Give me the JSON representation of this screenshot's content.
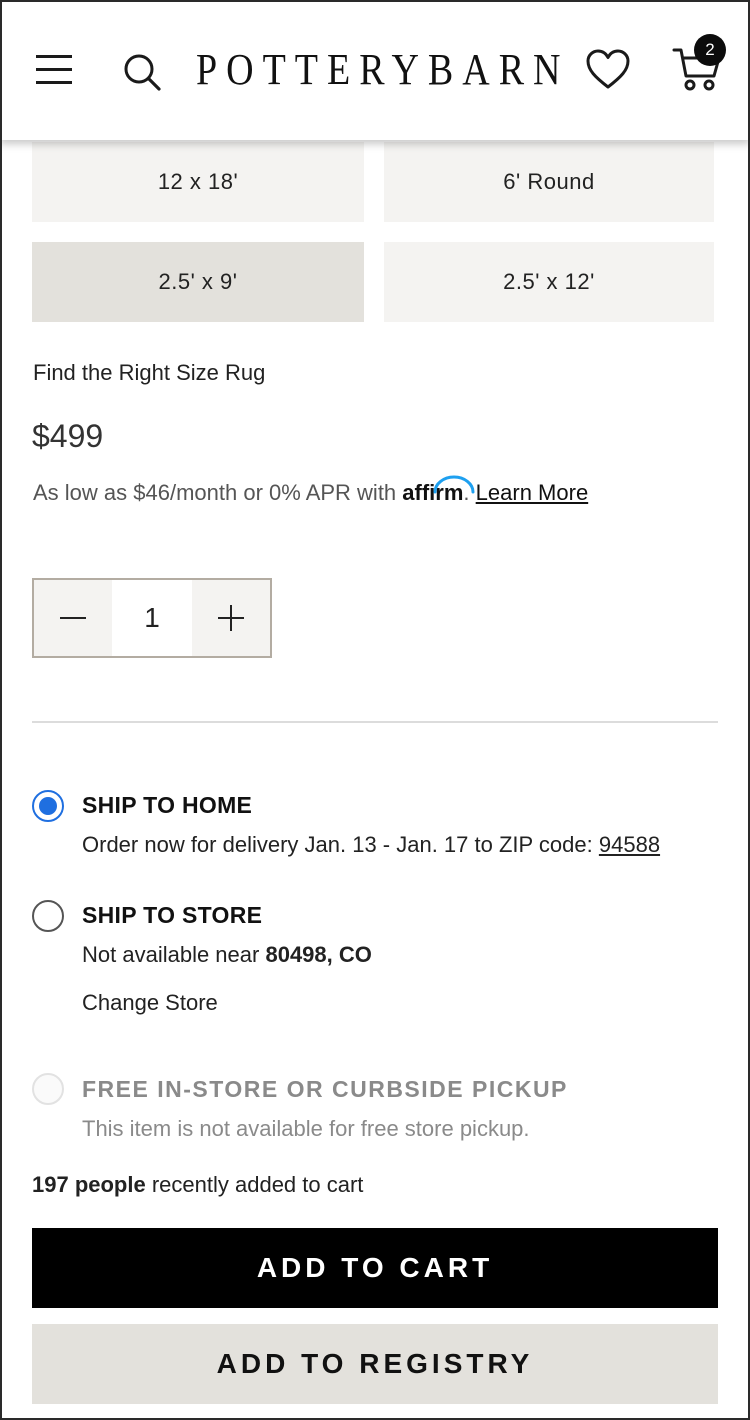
{
  "header": {
    "brand": "POTTERYBARN",
    "cart_count": "2",
    "icons": {
      "menu": "hamburger-menu-icon",
      "search": "search-icon",
      "wishlist": "heart-icon",
      "cart": "cart-icon"
    }
  },
  "sizes": {
    "options": [
      "12 x 18'",
      "6' Round",
      "2.5' x 9'",
      "2.5' x 12'"
    ],
    "selected": "2.5' x 9'"
  },
  "size_guide_link": "Find the Right Size Rug",
  "price": "$499",
  "financing": {
    "prefix": "As low as $46/month or 0% APR with",
    "brand": "affirm",
    "separator": ".",
    "link": "Learn More"
  },
  "quantity": {
    "value": "1",
    "decrement_symbol": "−",
    "increment_symbol": "+"
  },
  "shipping": {
    "ship_home": {
      "title": "SHIP TO HOME",
      "text": "Order now for delivery Jan. 13 - Jan. 17 to ZIP code:",
      "zip": "94588",
      "selected": true
    },
    "ship_store": {
      "title": "SHIP TO STORE",
      "text": "Not available near",
      "location": "80498, CO",
      "change_link": "Change Store",
      "selected": false
    },
    "pickup": {
      "title": "FREE IN-STORE OR CURBSIDE PICKUP",
      "text": "This item is not available for free store pickup.",
      "disabled": true
    }
  },
  "social_proof": {
    "count": "197 people",
    "text": "recently added to cart"
  },
  "buttons": {
    "add_to_cart": "ADD TO CART",
    "add_to_registry": "ADD TO REGISTRY"
  },
  "colors": {
    "primary_button": "#000000",
    "secondary_button": "#e3e1dc",
    "radio_selected": "#1f6fe0",
    "tile": "#f4f3f1",
    "tile_selected": "#e3e1dc"
  }
}
